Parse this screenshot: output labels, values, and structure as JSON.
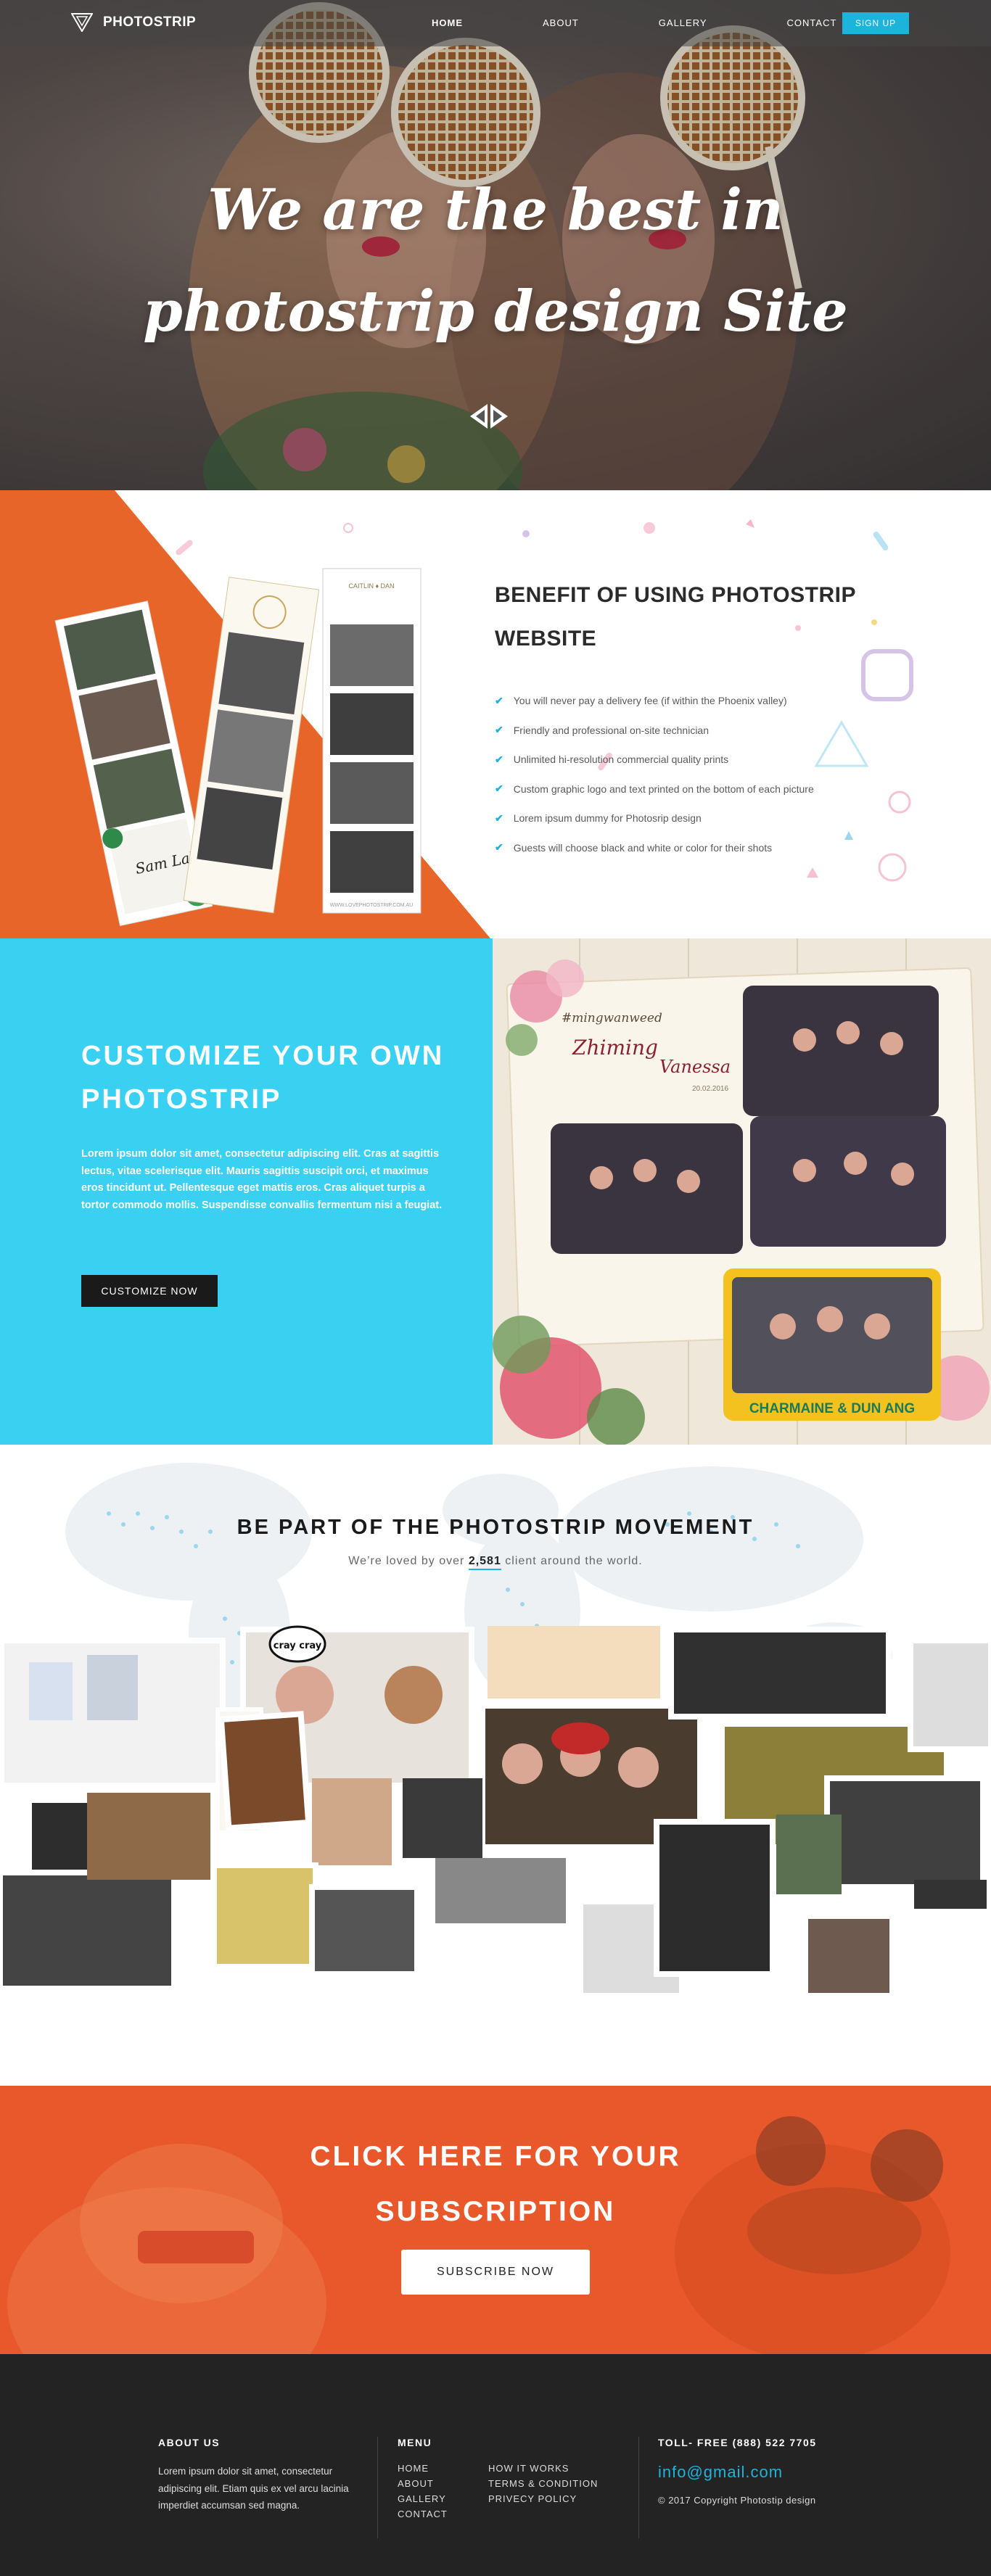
{
  "nav": {
    "brand": "PHOTOSTRIP",
    "links": [
      "HOME",
      "ABOUT",
      "GALLERY",
      "CONTACT"
    ],
    "signup": "SIGN UP"
  },
  "hero": {
    "title_line1": "We are the best in",
    "title_line2": "photostrip design Site"
  },
  "benefits": {
    "title": "BENEFIT OF USING PHOTOSTRIP WEBSITE",
    "items": [
      "You will never pay a delivery fee (if within the Phoenix valley)",
      "Friendly and professional on-site technician",
      "Unlimited hi-resolution commercial quality prints",
      "Custom graphic logo and text printed on the bottom of each picture",
      "Lorem ipsum dummy for Photosrip design",
      "Guests will choose black and white or color for their shots"
    ]
  },
  "customize": {
    "title": "CUSTOMIZE YOUR OWN PHOTOSTRIP",
    "text": "Lorem ipsum dolor sit amet, consectetur adipiscing elit. Cras at sagittis lectus, vitae scelerisque elit. Mauris sagittis suscipit orci, et maximus eros tincidunt ut. Pellentesque eget mattis eros. Cras aliquet turpis a tortor commodo mollis. Suspendisse convallis fermentum nisi a feugiat.",
    "button": "CUSTOMIZE NOW",
    "card_tag": "#mingwanweed",
    "card_name1": "Zhiming",
    "card_name2": "Vanessa",
    "card_date": "20.02.2016",
    "photo_caption": "CHARMAINE & DUN ANG",
    "strip_header": "CAITLIN ♦ DAN",
    "strip_footer": "WWW.LOVEPHOTOSTRIP.COM.AU",
    "strip_signature": "Sam Lahm"
  },
  "movement": {
    "title": "BE PART OF THE PHOTOSTRIP MOVEMENT",
    "sub_before": "We’re loved by over ",
    "count": "2,581",
    "sub_after": " client around the world.",
    "bubble": "cray cray"
  },
  "subscribe": {
    "title_line1": "CLICK HERE FOR YOUR",
    "title_line2": "SUBSCRIPTION",
    "button": "SUBSCRIBE NOW"
  },
  "footer": {
    "about_head": "ABOUT US",
    "about_text": "Lorem ipsum dolor sit amet, consectetur adipiscing elit. Etiam quis ex vel arcu lacinia imperdiet accumsan sed magna.",
    "menu_head": "MENU",
    "menu": [
      "HOME",
      "HOW IT WORKS",
      "ABOUT",
      "TERMS & CONDITION",
      "GALLERY",
      "PRIVECY POLICY",
      "CONTACT"
    ],
    "phone": "TOLL- FREE (888) 522 7705",
    "email": "info@gmail.com",
    "copyright": "© 2017 Copyright Photostip design"
  },
  "colors": {
    "accent": "#1db4dc",
    "orange": "#e8652a",
    "cyan": "#3ad0f2",
    "footer": "#232323"
  }
}
